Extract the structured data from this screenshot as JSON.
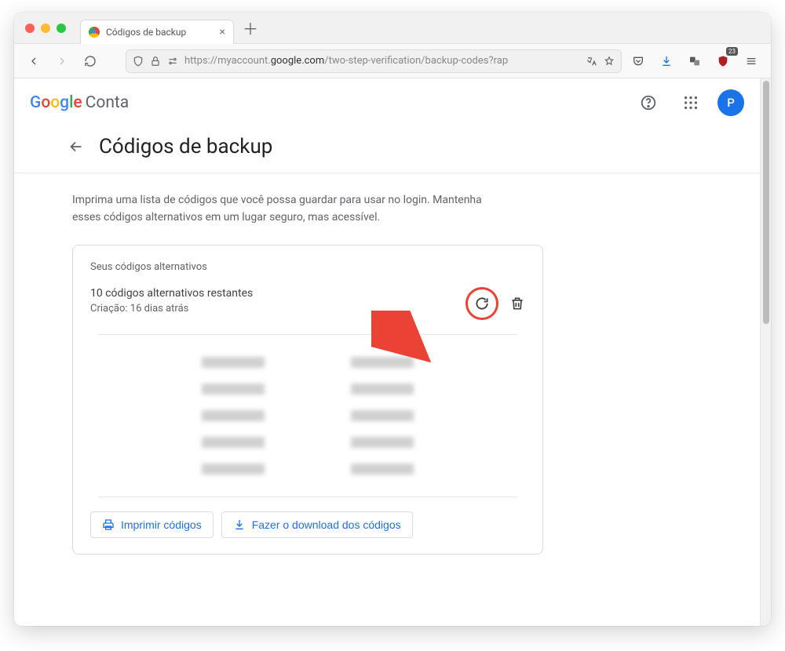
{
  "browser": {
    "tab_title": "Códigos de backup",
    "url_prefix": "https://myaccount.",
    "url_domain": "google.com",
    "url_path": "/two-step-verification/backup-codes?rap",
    "ublock_badge": "23"
  },
  "header": {
    "brand": "Google",
    "product": "Conta",
    "avatar_initial": "P"
  },
  "page": {
    "title": "Códigos de backup",
    "description": "Imprima uma lista de códigos que você possa guardar para usar no login. Mantenha esses códigos alternativos em um lugar seguro, mas acessível."
  },
  "card": {
    "label": "Seus códigos alternativos",
    "status": "10 códigos alternativos restantes",
    "created": "Criação: 16 dias atrás",
    "print_label": "Imprimir códigos",
    "download_label": "Fazer o download dos códigos"
  }
}
